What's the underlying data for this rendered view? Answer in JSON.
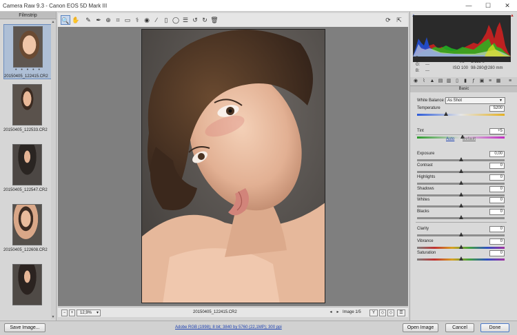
{
  "window": {
    "title": "Camera Raw 9.3  -  Canon EOS 5D Mark III",
    "minimize": "—",
    "maximize": "☐",
    "close": "✕"
  },
  "filmstrip": {
    "header": "Filmstrip",
    "items": [
      {
        "name": "20150405_122415.CR2",
        "stars": "• • • • •"
      },
      {
        "name": "20150405_122533.CR2"
      },
      {
        "name": "20150405_122547.CR2"
      },
      {
        "name": "20150405_122608.CR2"
      },
      {
        "name": ""
      }
    ]
  },
  "toolbar": {
    "tools": [
      "zoom-icon",
      "hand-icon",
      "eyedropper-icon",
      "color-sampler-icon",
      "target-adjust-icon",
      "crop-icon",
      "straighten-icon",
      "spot-removal-icon",
      "red-eye-icon",
      "brush-icon",
      "graduated-filter-icon",
      "radial-filter-icon",
      "preferences-icon",
      "rotate-left-icon",
      "rotate-right-icon",
      "trash-icon"
    ]
  },
  "status": {
    "zoom": "12,9%",
    "filename": "20150405_122415.CR2",
    "image_count": "Image 1/5"
  },
  "histogram": {
    "r_label": "R:",
    "g_label": "G:",
    "b_label": "B:",
    "r_val": "---",
    "g_val": "---",
    "b_val": "---",
    "aperture": "f/8",
    "shutter": "1/125 s",
    "iso": "ISO 100",
    "lens": "98-280@280 mm"
  },
  "panel": {
    "title": "Basic",
    "white_balance_label": "White Balance:",
    "white_balance_value": "As Shot",
    "auto": "Auto",
    "default": "Default",
    "sliders": [
      {
        "label": "Temperature",
        "value": "5200",
        "level": 0.33
      },
      {
        "label": "Tint",
        "value": "+5",
        "level": 0.52
      },
      {
        "label": "Exposure",
        "value": "0,00",
        "level": 0.5
      },
      {
        "label": "Contrast",
        "value": "0",
        "level": 0.5
      },
      {
        "label": "Highlights",
        "value": "0",
        "level": 0.5
      },
      {
        "label": "Shadows",
        "value": "0",
        "level": 0.5
      },
      {
        "label": "Whites",
        "value": "0",
        "level": 0.5
      },
      {
        "label": "Blacks",
        "value": "0",
        "level": 0.5
      },
      {
        "label": "Clarity",
        "value": "0",
        "level": 0.5
      },
      {
        "label": "Vibrance",
        "value": "0",
        "level": 0.5
      },
      {
        "label": "Saturation",
        "value": "0",
        "level": 0.5
      }
    ]
  },
  "bottom": {
    "save_image": "Save Image...",
    "workflow": "Adobe RGB (1998); 8 bit; 3840 by 5760 (22,1MP); 300 ppi",
    "open_image": "Open Image",
    "cancel": "Cancel",
    "done": "Done"
  }
}
